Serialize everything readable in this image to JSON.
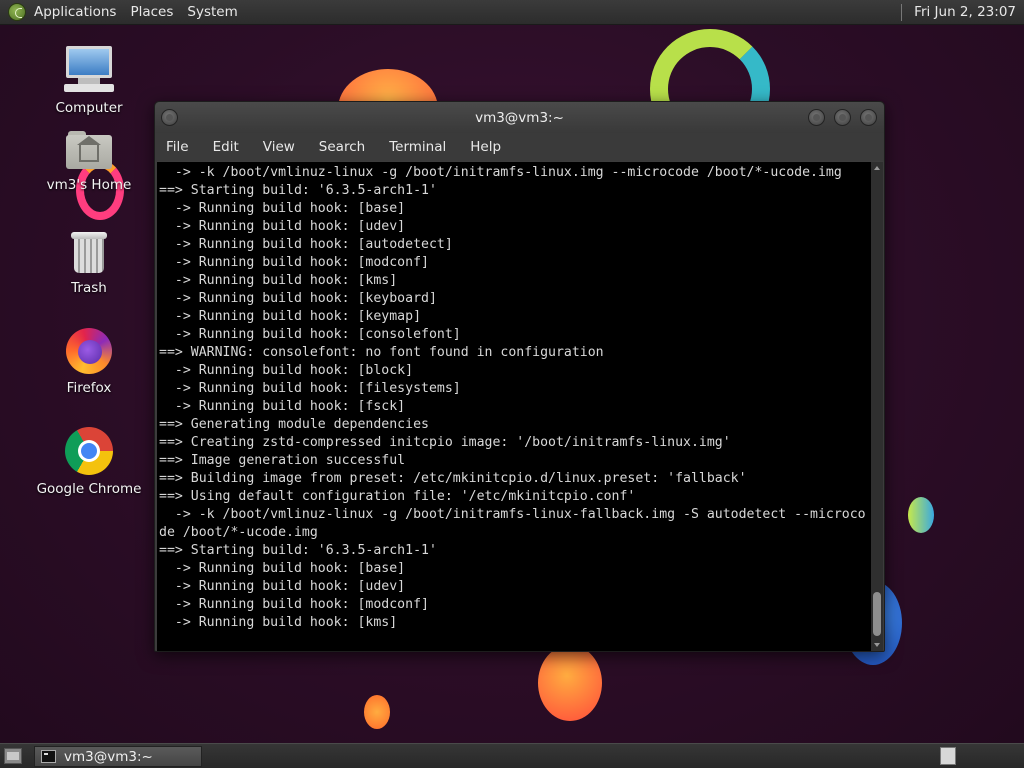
{
  "top_panel": {
    "menus": [
      "Applications",
      "Places",
      "System"
    ],
    "clock": "Fri Jun  2, 23:07"
  },
  "desktop_icons": [
    {
      "label": "Computer",
      "icon": "computer-icon"
    },
    {
      "label": "vm3's Home",
      "icon": "home-folder-icon"
    },
    {
      "label": "Trash",
      "icon": "trash-icon"
    },
    {
      "label": "Firefox",
      "icon": "firefox-icon"
    },
    {
      "label": "Google Chrome",
      "icon": "chrome-icon"
    }
  ],
  "window": {
    "title": "vm3@vm3:~",
    "menus": [
      "File",
      "Edit",
      "View",
      "Search",
      "Terminal",
      "Help"
    ]
  },
  "terminal": {
    "lines": [
      "  -> -k /boot/vmlinuz-linux -g /boot/initramfs-linux.img --microcode /boot/*-ucode.img",
      "==> Starting build: '6.3.5-arch1-1'",
      "  -> Running build hook: [base]",
      "  -> Running build hook: [udev]",
      "  -> Running build hook: [autodetect]",
      "  -> Running build hook: [modconf]",
      "  -> Running build hook: [kms]",
      "  -> Running build hook: [keyboard]",
      "  -> Running build hook: [keymap]",
      "  -> Running build hook: [consolefont]",
      "==> WARNING: consolefont: no font found in configuration",
      "  -> Running build hook: [block]",
      "  -> Running build hook: [filesystems]",
      "  -> Running build hook: [fsck]",
      "==> Generating module dependencies",
      "==> Creating zstd-compressed initcpio image: '/boot/initramfs-linux.img'",
      "==> Image generation successful",
      "==> Building image from preset: /etc/mkinitcpio.d/linux.preset: 'fallback'",
      "==> Using default configuration file: '/etc/mkinitcpio.conf'",
      "  -> -k /boot/vmlinuz-linux -g /boot/initramfs-linux-fallback.img -S autodetect --microco",
      "de /boot/*-ucode.img",
      "==> Starting build: '6.3.5-arch1-1'",
      "  -> Running build hook: [base]",
      "  -> Running build hook: [udev]",
      "  -> Running build hook: [modconf]",
      "  -> Running build hook: [kms]"
    ]
  },
  "taskbar": {
    "task_label": "vm3@vm3:~"
  }
}
